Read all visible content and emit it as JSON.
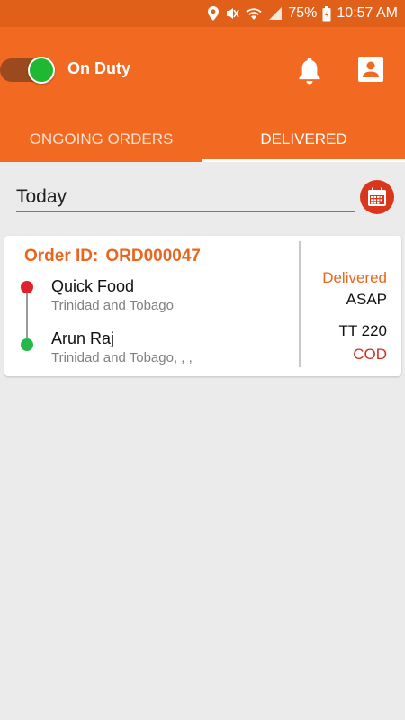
{
  "status_bar": {
    "battery": "75%",
    "time": "10:57 AM"
  },
  "header": {
    "duty_label": "On Duty",
    "duty_on": true
  },
  "tabs": [
    {
      "label": "ONGOING ORDERS",
      "active": false
    },
    {
      "label": "DELIVERED",
      "active": true
    }
  ],
  "filter": {
    "date_label": "Today"
  },
  "order": {
    "id_label": "Order ID:",
    "id_value": "ORD000047",
    "pickup": {
      "name": "Quick Food",
      "address": "Trinidad and Tobago"
    },
    "dropoff": {
      "name": "Arun Raj",
      "address": "Trinidad and Tobago, , ,"
    },
    "status": "Delivered",
    "time": "ASAP",
    "amount": "TT 220",
    "payment": "COD"
  },
  "icons": {
    "status": [
      "location-icon",
      "mute-icon",
      "wifi-icon",
      "signal-icon",
      "battery-icon"
    ],
    "header": [
      "bell-icon",
      "profile-icon"
    ],
    "filter": "calendar-icon"
  },
  "colors": {
    "primary": "#f26a21",
    "status_bar": "#e0601a",
    "accent_orange": "#e9661f",
    "pickup_dot": "#e0222a",
    "drop_dot": "#27b84a",
    "toggle_on": "#1fb832",
    "cod_red": "#d42d1f",
    "calendar_btn": "#d9371b"
  }
}
